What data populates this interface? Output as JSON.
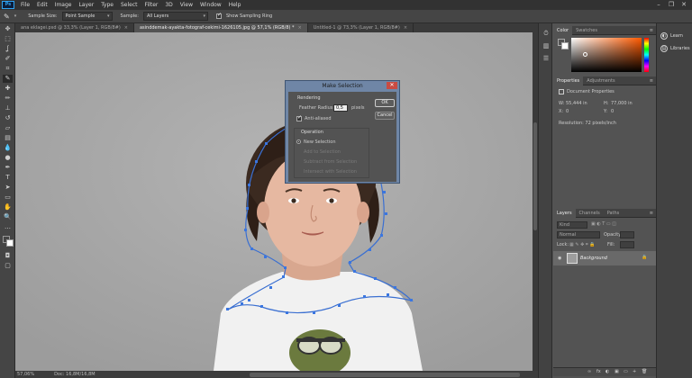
{
  "app": {
    "logo": "Ps",
    "menu": [
      "File",
      "Edit",
      "Image",
      "Layer",
      "Type",
      "Select",
      "Filter",
      "3D",
      "View",
      "Window",
      "Help"
    ],
    "window_controls": [
      "–",
      "❐",
      "✕"
    ]
  },
  "options_bar": {
    "sample_size_label": "Sample Size:",
    "sample_size_value": "Point Sample",
    "sample_label": "Sample:",
    "sample_value": "All Layers",
    "show_ring_label": "Show Sampling Ring",
    "show_ring_checked": true
  },
  "doc_tabs": [
    {
      "label": "ana eklagei.psd @ 33,3% (Layer 1, RGB/8#)",
      "active": false
    },
    {
      "label": "asinddemak-ayakta-fotograf-cekimi-1626105.jpg @ 57,1% (RGB/8) *",
      "active": true
    },
    {
      "label": "Untitled-1 @ 73,3% (Layer 1, RGB/8#)",
      "active": false
    }
  ],
  "status_bar": {
    "zoom": "57,06%",
    "doc": "Doc: 16,8M/16,8M"
  },
  "dialog": {
    "title": "Make Selection",
    "close": "✕",
    "rendering_label": "Rendering",
    "feather_label": "Feather Radius:",
    "feather_value": "0,5",
    "feather_unit": "pixels",
    "antialiased_label": "Anti-aliased",
    "antialiased_checked": true,
    "ok_label": "OK",
    "cancel_label": "Cancel",
    "operation_label": "Operation",
    "operations": [
      {
        "label": "New Selection",
        "selected": true,
        "enabled": true
      },
      {
        "label": "Add to Selection",
        "selected": false,
        "enabled": false
      },
      {
        "label": "Subtract from Selection",
        "selected": false,
        "enabled": false
      },
      {
        "label": "Intersect with Selection",
        "selected": false,
        "enabled": false
      }
    ]
  },
  "color_panel": {
    "tabs": [
      "Color",
      "Swatches"
    ],
    "foreground": "#535353",
    "background": "#ffffff",
    "hue_color": "#ff5a00"
  },
  "properties_panel": {
    "tabs": [
      "Properties",
      "Adjustments"
    ],
    "heading": "Document Properties",
    "w_label": "W:",
    "w_value": "55,444 in",
    "h_label": "H:",
    "h_value": "77,000 in",
    "x_label": "X:",
    "x_value": "0",
    "y_label": "Y:",
    "y_value": "0",
    "resolution": "Resolution: 72 pixels/inch"
  },
  "layers_panel": {
    "tabs": [
      "Layers",
      "Channels",
      "Paths"
    ],
    "kind_placeholder": "Kind",
    "blend_mode": "Normal",
    "opacity_label": "Opacity:",
    "lock_label": "Lock:",
    "fill_label": "Fill:",
    "layer_name": "Background",
    "bottom_icons": [
      "∞",
      "fx",
      "◐",
      "▣",
      "▭",
      "+",
      "🗑"
    ]
  },
  "right_dock": {
    "learn_label": "Learn",
    "libraries_label": "Libraries"
  }
}
